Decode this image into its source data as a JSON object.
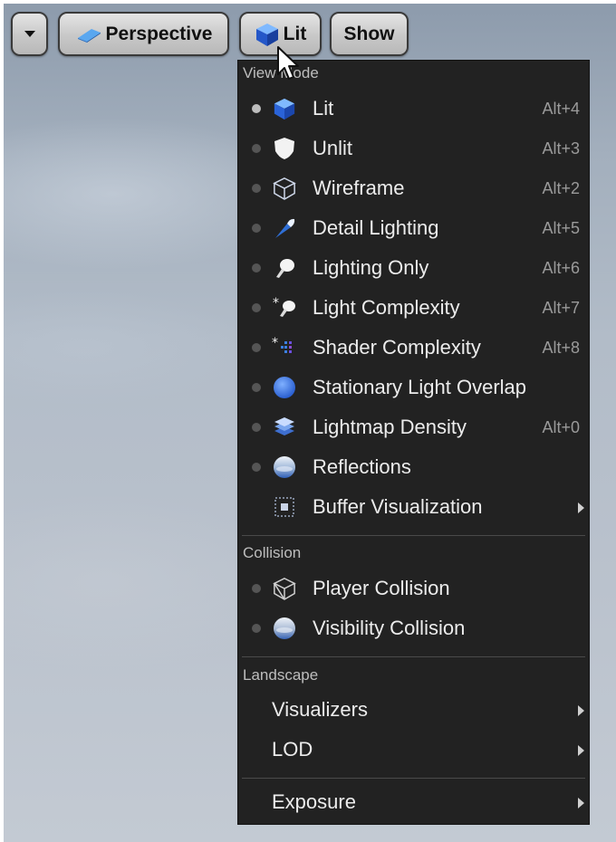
{
  "toolbar": {
    "perspective_label": "Perspective",
    "lit_label": "Lit",
    "show_label": "Show"
  },
  "menu": {
    "view_mode": {
      "header": "View Mode",
      "items": [
        {
          "label": "Lit",
          "shortcut": "Alt+4",
          "icon": "lit-cube-icon",
          "active": true
        },
        {
          "label": "Unlit",
          "shortcut": "Alt+3",
          "icon": "unlit-shield-icon"
        },
        {
          "label": "Wireframe",
          "shortcut": "Alt+2",
          "icon": "wireframe-cube-icon"
        },
        {
          "label": "Detail Lighting",
          "shortcut": "Alt+5",
          "icon": "detail-lighting-icon"
        },
        {
          "label": "Lighting Only",
          "shortcut": "Alt+6",
          "icon": "lighting-only-icon"
        },
        {
          "label": "Light Complexity",
          "shortcut": "Alt+7",
          "icon": "light-complexity-icon"
        },
        {
          "label": "Shader Complexity",
          "shortcut": "Alt+8",
          "icon": "shader-complexity-icon"
        },
        {
          "label": "Stationary Light Overlap",
          "shortcut": "",
          "icon": "stationary-light-overlap-icon"
        },
        {
          "label": "Lightmap Density",
          "shortcut": "Alt+0",
          "icon": "lightmap-density-icon"
        },
        {
          "label": "Reflections",
          "shortcut": "",
          "icon": "reflections-icon"
        },
        {
          "label": "Buffer Visualization",
          "shortcut": "",
          "icon": "buffer-visualization-icon",
          "submenu": true
        }
      ]
    },
    "collision": {
      "header": "Collision",
      "items": [
        {
          "label": "Player Collision",
          "icon": "player-collision-icon"
        },
        {
          "label": "Visibility Collision",
          "icon": "visibility-collision-icon"
        }
      ]
    },
    "landscape": {
      "header": "Landscape",
      "items": [
        {
          "label": "Visualizers",
          "submenu": true
        },
        {
          "label": "LOD",
          "submenu": true
        }
      ]
    },
    "exposure": {
      "label": "Exposure",
      "submenu": true
    }
  },
  "colors": {
    "menu_background": "#222222",
    "accent_blue": "#2f6fd6"
  }
}
